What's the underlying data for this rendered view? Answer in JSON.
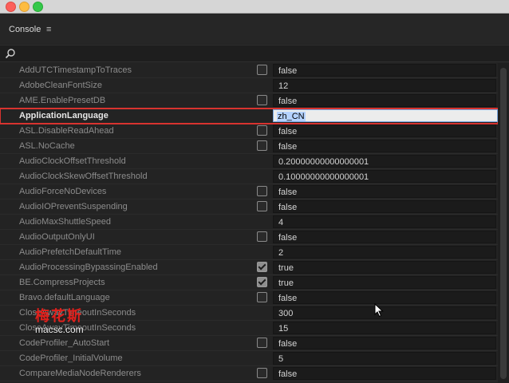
{
  "window": {
    "traffic_lights": [
      "close",
      "minimize",
      "zoom"
    ]
  },
  "panel": {
    "title": "Console",
    "menu_icon": "hamburger-menu-icon"
  },
  "search": {
    "placeholder": "",
    "value": "",
    "icon": "search-icon"
  },
  "rows": [
    {
      "name": "AddUTCTimestampToTraces",
      "value": "false",
      "checkbox": "unchecked"
    },
    {
      "name": "AdobeCleanFontSize",
      "value": "12",
      "checkbox": "none"
    },
    {
      "name": "AME.EnablePresetDB",
      "value": "false",
      "checkbox": "unchecked"
    },
    {
      "name": "ApplicationLanguage",
      "value": "zh_CN",
      "checkbox": "none",
      "selected": true
    },
    {
      "name": "ASL.DisableReadAhead",
      "value": "false",
      "checkbox": "unchecked"
    },
    {
      "name": "ASL.NoCache",
      "value": "false",
      "checkbox": "unchecked"
    },
    {
      "name": "AudioClockOffsetThreshold",
      "value": "0.20000000000000001",
      "checkbox": "none"
    },
    {
      "name": "AudioClockSkewOffsetThreshold",
      "value": "0.10000000000000001",
      "checkbox": "none"
    },
    {
      "name": "AudioForceNoDevices",
      "value": "false",
      "checkbox": "unchecked"
    },
    {
      "name": "AudioIOPreventSuspending",
      "value": "false",
      "checkbox": "unchecked"
    },
    {
      "name": "AudioMaxShuttleSpeed",
      "value": "4",
      "checkbox": "none"
    },
    {
      "name": "AudioOutputOnlyUI",
      "value": "false",
      "checkbox": "unchecked"
    },
    {
      "name": "AudioPrefetchDefaultTime",
      "value": "2",
      "checkbox": "none"
    },
    {
      "name": "AudioProcessingBypassingEnabled",
      "value": "true",
      "checkbox": "checked"
    },
    {
      "name": "BE.CompressProjects",
      "value": "true",
      "checkbox": "checked"
    },
    {
      "name": "Bravo.defaultLanguage",
      "value": "false",
      "checkbox": "unchecked"
    },
    {
      "name": "CloseAwayTimeoutInSeconds",
      "value": "300",
      "checkbox": "none"
    },
    {
      "name": "CloseAwayTimeoutInSeconds",
      "value": "15",
      "checkbox": "none"
    },
    {
      "name": "CodeProfiler_AutoStart",
      "value": "false",
      "checkbox": "unchecked"
    },
    {
      "name": "CodeProfiler_InitialVolume",
      "value": "5",
      "checkbox": "none"
    },
    {
      "name": "CompareMediaNodeRenderers",
      "value": "false",
      "checkbox": "unchecked"
    }
  ],
  "watermark": {
    "logo_text": "梅花斯",
    "url": "macsc.com"
  }
}
